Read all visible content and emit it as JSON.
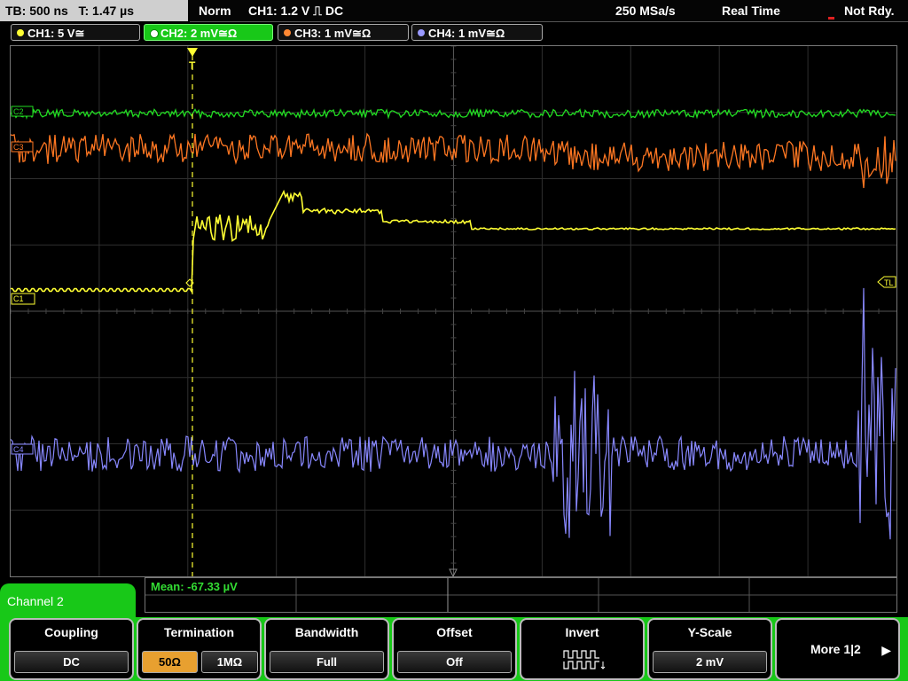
{
  "status_bar": {
    "timebase": "TB: 500 ns",
    "trigger_time": "T: 1.47 µs",
    "trigger_mode": "Norm",
    "trigger_info": "CH1: 1.2 V ⎍ DC",
    "sample_rate": "250 MSa/s",
    "acq_mode": "Real Time",
    "state": "Not Rdy."
  },
  "channels": [
    {
      "label": "CH1: 5 V≅",
      "color": "#ffff33"
    },
    {
      "label": "CH2: 2 mV≅Ω",
      "color": "#ffffff"
    },
    {
      "label": "CH3: 1 mV≅Ω",
      "color": "#ff8833"
    },
    {
      "label": "CH4: 1 mV≅Ω",
      "color": "#9999ff"
    }
  ],
  "screen_markers": {
    "ch1": "C1",
    "ch2": "C2",
    "ch3": "C3",
    "ch4": "C4",
    "trigger_level": "TL",
    "trigger_pos": "T"
  },
  "measurement": {
    "mean": "Mean: -67.33 µV"
  },
  "menu": {
    "title": "Channel 2",
    "coupling": {
      "label": "Coupling",
      "value": "DC"
    },
    "termination": {
      "label": "Termination",
      "opt1": "50Ω",
      "opt2": "1MΩ"
    },
    "bandwidth": {
      "label": "Bandwidth",
      "value": "Full"
    },
    "offset": {
      "label": "Offset",
      "value": "Off"
    },
    "invert": {
      "label": "Invert"
    },
    "yscale": {
      "label": "Y-Scale",
      "value": "2 mV"
    },
    "more": {
      "label": "More 1|2"
    }
  },
  "colors": {
    "ch1": "#ffff33",
    "ch2": "#22dd22",
    "ch3": "#ff7722",
    "ch4": "#8888ff",
    "menu_accent": "#18c818",
    "selected_option": "#e8a030"
  }
}
